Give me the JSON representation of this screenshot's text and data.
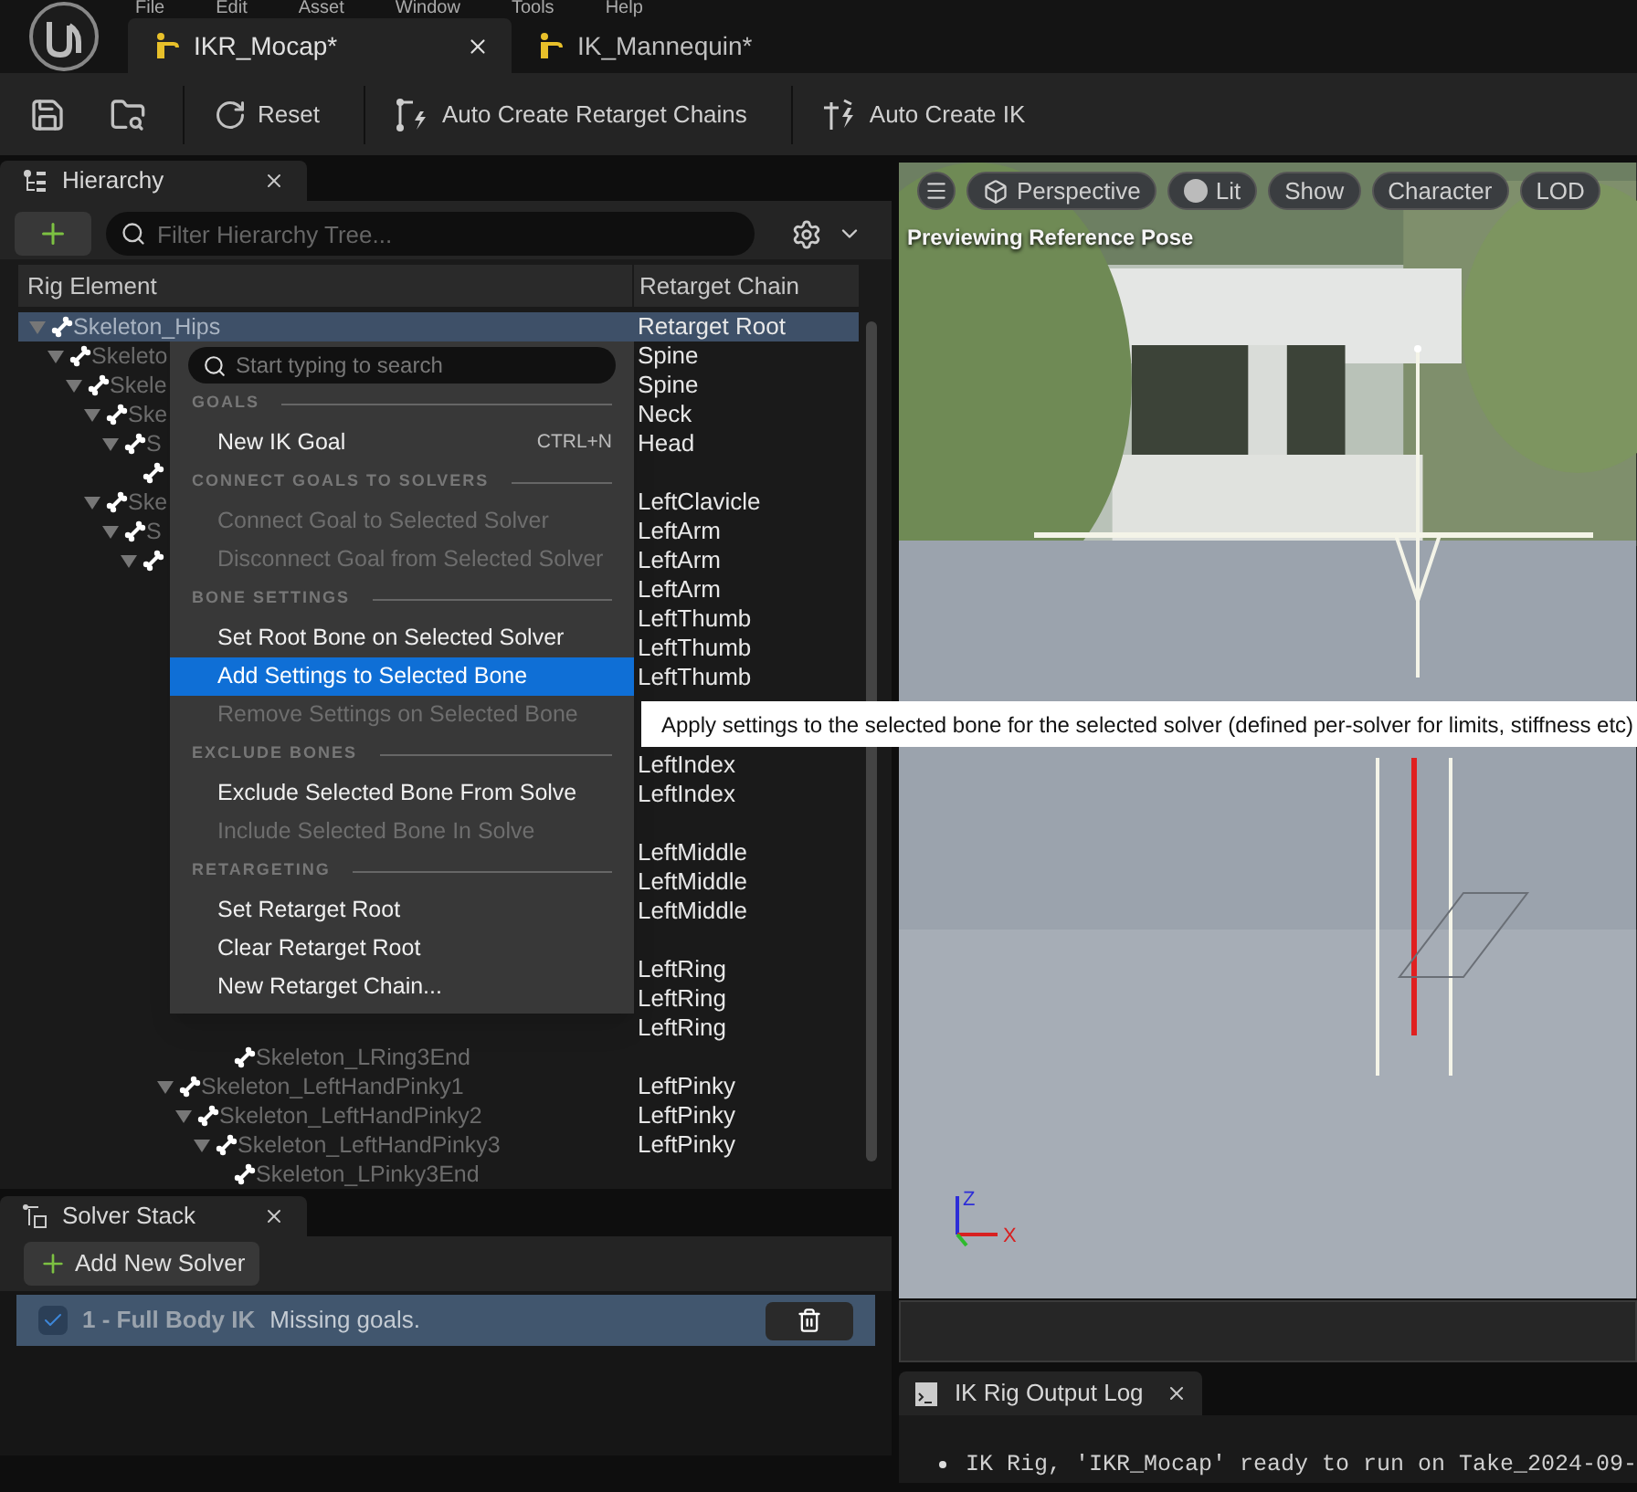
{
  "menu_bar": [
    "File",
    "Edit",
    "Asset",
    "Window",
    "Tools",
    "Help"
  ],
  "tabs": [
    {
      "label": "IKR_Mocap*",
      "selected": true
    },
    {
      "label": "IK_Mannequin*",
      "selected": false
    }
  ],
  "toolbar": [
    {
      "kind": "save"
    },
    {
      "kind": "browse"
    },
    {
      "kind": "reset",
      "label": "Reset"
    },
    {
      "kind": "chains",
      "label": "Auto Create Retarget Chains"
    },
    {
      "kind": "ik",
      "label": "Auto Create IK"
    }
  ],
  "hierarchy": {
    "title": "Hierarchy",
    "filter_placeholder": "Filter Hierarchy Tree...",
    "columns": [
      "Rig Element",
      "Retarget Chain"
    ],
    "tree": [
      {
        "name": "Skeleton_Hips",
        "chain": "Retarget Root",
        "selected": true,
        "children": [
          {
            "name": "Skeleto",
            "chain": "Spine",
            "selected": false,
            "children": [
              {
                "name": "Skele",
                "chain": "Spine",
                "selected": false,
                "children": [
                  {
                    "name": "Ske",
                    "chain": "Neck",
                    "selected": false,
                    "children": [
                      {
                        "name": "S",
                        "chain": "Head",
                        "selected": false,
                        "children": [
                          {
                            "selected": false
                          }
                        ]
                      }
                    ]
                  },
                  {
                    "name": "Ske",
                    "chain": "LeftClavicle",
                    "selected": false,
                    "children": [
                      {
                        "name": "S",
                        "chain": "LeftArm",
                        "selected": false,
                        "children": [
                          {
                            "chain": "LeftArm",
                            "selected": false,
                            "children": [
                              {
                                "chain": "LeftArm",
                                "selected": false,
                                "children": [
                                  {
                                    "chain": "LeftThumb",
                                    "selected": false,
                                    "children": [
                                      {
                                        "chain": "LeftThumb",
                                        "selected": false,
                                        "children": [
                                          {
                                            "chain": "LeftThumb",
                                            "selected": false,
                                            "children": [
                                              {
                                                "selected": false
                                              }
                                            ]
                                          }
                                        ]
                                      }
                                    ]
                                  },
                                  {
                                    "selected": false,
                                    "children": [
                                      {
                                        "chain": "LeftIndex",
                                        "selected": false,
                                        "children": [
                                          {
                                            "chain": "LeftIndex",
                                            "selected": false,
                                            "children": [
                                              {
                                                "selected": false
                                              }
                                            ]
                                          }
                                        ]
                                      }
                                    ]
                                  },
                                  {
                                    "chain": "LeftMiddle",
                                    "selected": false,
                                    "children": [
                                      {
                                        "chain": "LeftMiddle",
                                        "selected": false,
                                        "children": [
                                          {
                                            "chain": "LeftMiddle",
                                            "selected": false,
                                            "children": [
                                              {
                                                "selected": false
                                              }
                                            ]
                                          }
                                        ]
                                      }
                                    ]
                                  },
                                  {
                                    "chain": "LeftRing",
                                    "selected": false,
                                    "children": [
                                      {
                                        "chain": "LeftRing",
                                        "selected": false,
                                        "children": [
                                          {
                                            "chain": "LeftRing",
                                            "selected": false,
                                            "children": [
                                              {
                                                "name": "Skeleton_LRing3End",
                                                "selected": false
                                              }
                                            ]
                                          }
                                        ]
                                      }
                                    ]
                                  },
                                  {
                                    "name": "Skeleton_LeftHandPinky1",
                                    "chain": "LeftPinky",
                                    "selected": false,
                                    "children": [
                                      {
                                        "name": "Skeleton_LeftHandPinky2",
                                        "chain": "LeftPinky",
                                        "selected": false,
                                        "children": [
                                          {
                                            "name": "Skeleton_LeftHandPinky3",
                                            "chain": "LeftPinky",
                                            "selected": false,
                                            "children": [
                                              {
                                                "name": "Skeleton_LPinky3End",
                                                "selected": false
                                              }
                                            ]
                                          }
                                        ]
                                      }
                                    ]
                                  }
                                ]
                              }
                            ]
                          }
                        ]
                      }
                    ]
                  }
                ]
              }
            ]
          }
        ]
      }
    ]
  },
  "context_menu": {
    "search_placeholder": "Start typing to search",
    "sections": [
      {
        "heading": "GOALS",
        "items": [
          {
            "label": "New IK Goal",
            "shortcut": "CTRL+N",
            "disabled": false,
            "selected": false
          }
        ]
      },
      {
        "heading": "CONNECT GOALS TO SOLVERS",
        "items": [
          {
            "label": "Connect Goal to Selected Solver",
            "disabled": true,
            "selected": false
          },
          {
            "label": "Disconnect Goal from Selected Solver",
            "disabled": true,
            "selected": false
          }
        ]
      },
      {
        "heading": "BONE SETTINGS",
        "items": [
          {
            "label": "Set Root Bone on Selected Solver",
            "disabled": false,
            "selected": false
          },
          {
            "label": "Add Settings to Selected Bone",
            "disabled": false,
            "selected": true
          },
          {
            "label": "Remove Settings on Selected Bone",
            "disabled": true,
            "selected": false
          }
        ]
      },
      {
        "heading": "EXCLUDE BONES",
        "items": [
          {
            "label": "Exclude Selected Bone From Solve",
            "disabled": false,
            "selected": false
          },
          {
            "label": "Include Selected Bone In Solve",
            "disabled": true,
            "selected": false
          }
        ]
      },
      {
        "heading": "RETARGETING",
        "items": [
          {
            "label": "Set Retarget Root",
            "disabled": false,
            "selected": false
          },
          {
            "label": "Clear Retarget Root",
            "disabled": false,
            "selected": false
          },
          {
            "label": "New Retarget Chain...",
            "disabled": false,
            "selected": false
          }
        ]
      }
    ]
  },
  "tooltip": "Apply settings to the selected bone for the selected solver (defined per-solver for limits, stiffness etc)",
  "solver_stack": {
    "title": "Solver Stack",
    "add_button": "Add New Solver",
    "solvers": [
      {
        "name": "1 - Full Body IK",
        "status": "Missing goals.",
        "checked": true,
        "selected": true
      }
    ]
  },
  "viewport": {
    "buttons": [
      {
        "kind": "menu"
      },
      {
        "kind": "perspective",
        "label": "Perspective"
      },
      {
        "kind": "lit",
        "label": "Lit"
      },
      {
        "kind": "plain",
        "label": "Show"
      },
      {
        "kind": "plain",
        "label": "Character"
      },
      {
        "kind": "plain",
        "label": "LOD"
      }
    ],
    "overlay_text": "Previewing Reference Pose",
    "axes": [
      "Z",
      "X"
    ]
  },
  "output_log": {
    "title": "IK Rig Output Log",
    "lines": [
      "IK Rig, 'IKR_Mocap' ready to run on Take_2024-09-"
    ]
  }
}
